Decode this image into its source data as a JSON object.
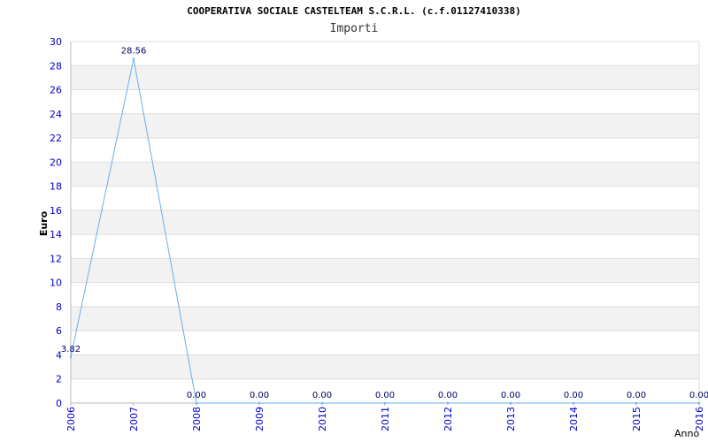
{
  "chart_data": {
    "type": "line",
    "title": "COOPERATIVA SOCIALE CASTELTEAM S.C.R.L. (c.f.01127410338)",
    "subtitle": "Importi",
    "xlabel": "Anno",
    "ylabel": "Euro",
    "categories": [
      "2006",
      "2007",
      "2008",
      "2009",
      "2010",
      "2011",
      "2012",
      "2013",
      "2014",
      "2015",
      "2016"
    ],
    "series": [
      {
        "values": [
          3.82,
          28.56,
          0.0,
          0.0,
          0.0,
          0.0,
          0.0,
          0.0,
          0.0,
          0.0,
          0.0
        ],
        "labels": [
          "3.82",
          "28.56",
          "0.00",
          "0.00",
          "0.00",
          "0.00",
          "0.00",
          "0.00",
          "0.00",
          "0.00",
          "0.00"
        ],
        "color": "#6aaee8"
      }
    ],
    "ylim": [
      0,
      30
    ],
    "yticks": [
      "0",
      "2",
      "4",
      "6",
      "8",
      "10",
      "12",
      "14",
      "16",
      "18",
      "20",
      "22",
      "24",
      "26",
      "28",
      "30"
    ],
    "grid": true,
    "colors": {
      "axis_text": "#0000cc",
      "band": "#f2f2f2",
      "grid": "#dddddd",
      "label": "#000066"
    }
  }
}
